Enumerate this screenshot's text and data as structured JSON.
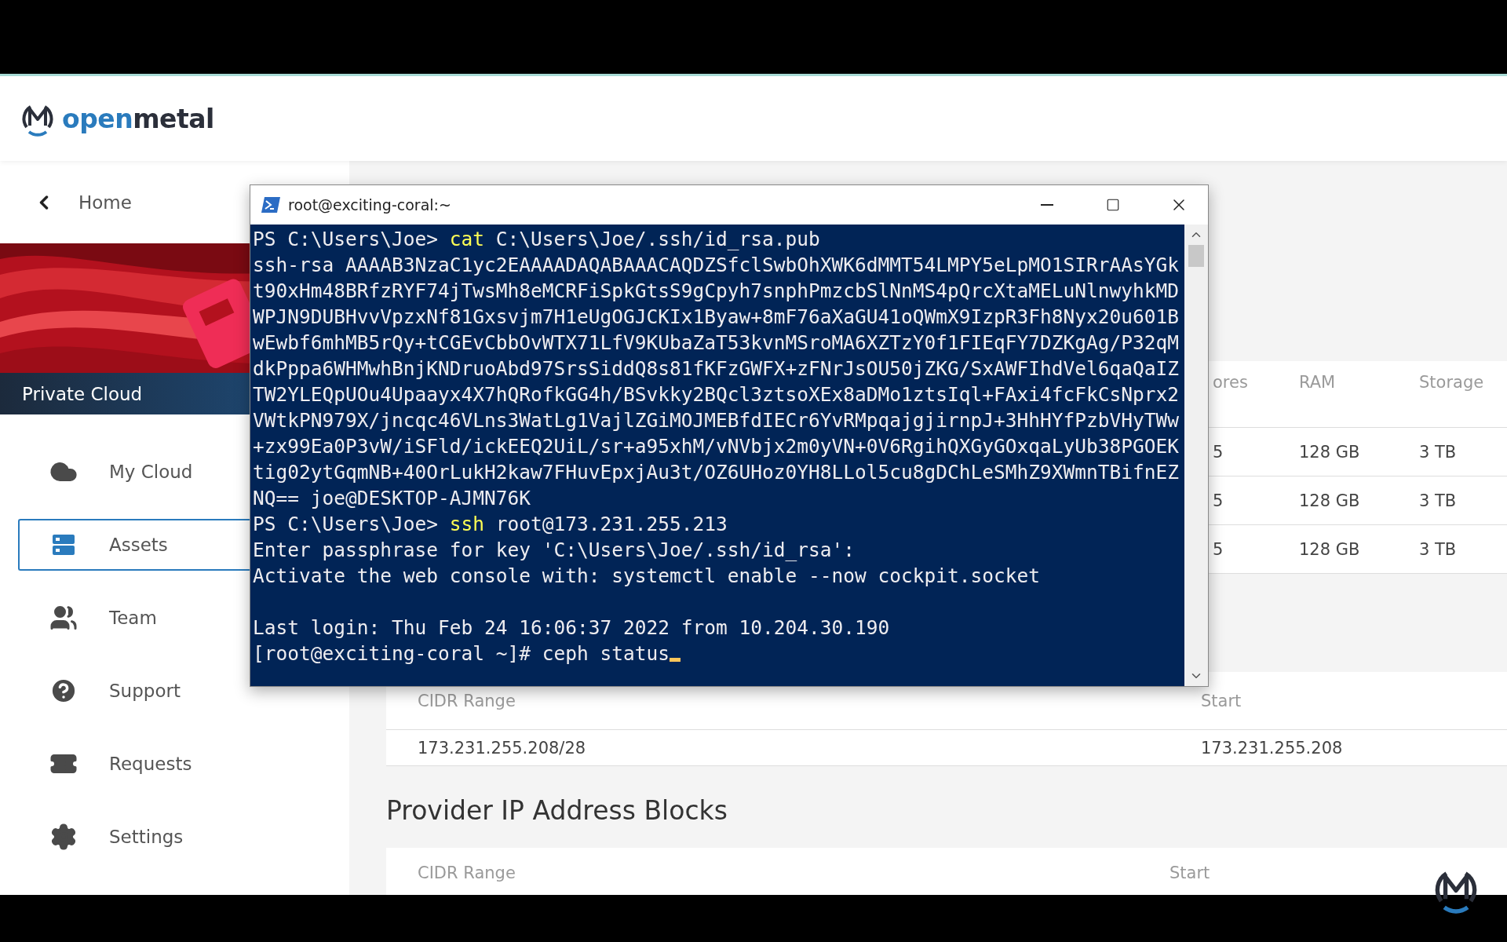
{
  "header": {
    "logo": {
      "part_1": "open",
      "part_2": "metal"
    }
  },
  "sidebar": {
    "back": {
      "label": "Home"
    },
    "banner": {
      "kind": "picture",
      "title": "Private Cloud"
    },
    "items": [
      {
        "label": "My Cloud",
        "selected": false
      },
      {
        "label": "Assets",
        "selected": true
      },
      {
        "label": "Team",
        "selected": false
      },
      {
        "label": "Support",
        "selected": false
      },
      {
        "label": "Requests",
        "selected": false
      },
      {
        "label": "Settings",
        "selected": false
      }
    ]
  },
  "content": {
    "hardware_table": {
      "columns": [
        "ores",
        "RAM",
        "Storage"
      ],
      "rows": [
        [
          "5",
          "128 GB",
          "3 TB"
        ],
        [
          "5",
          "128 GB",
          "3 TB"
        ],
        [
          "5",
          "128 GB",
          "3 TB"
        ]
      ]
    },
    "ip_table": {
      "columns": [
        "CIDR Range",
        "Start"
      ],
      "rows": [
        [
          "173.231.255.208/28",
          "173.231.255.208"
        ]
      ]
    },
    "provider_section": {
      "title": "Provider IP Address Blocks",
      "columns": [
        "CIDR Range",
        "Start"
      ]
    }
  },
  "terminal": {
    "title": "root@exciting-coral:~",
    "lines": [
      {
        "kind": "command",
        "prompt": "PS C:\\Users\\Joe>",
        "command": "cat",
        "args": "C:\\Users\\Joe/.ssh/id_rsa.pub"
      },
      {
        "kind": "output",
        "text": "ssh-rsa AAAAB3NzaC1yc2EAAAADAQABAAACAQDZSfclSwbOhXWK6dMMT54LMPY5eLpMO1SIRrAAsYGk"
      },
      {
        "kind": "output",
        "text": "t90xHm48BRfzRYF74jTwsMh8eMCRFiSpkGtsS9gCpyh7snphPmzcbSlNnMS4pQrcXtaMELuNlnwyhkMD"
      },
      {
        "kind": "output",
        "text": "WPJN9DUBHvvVpzxNf81Gxsvjm7H1eUgOGJCKIx1Byaw+8mF76aXaGU41oQWmX9IzpR3Fh8Nyx20u601B"
      },
      {
        "kind": "output",
        "text": "wEwbf6mhMB5rQy+tCGEvCbbOvWTX71LfV9KUbaZaT53kvnMSroMA6XZTzY0f1FIEqFY7DZKgAg/P32qM"
      },
      {
        "kind": "output",
        "text": "dkPppa6WHMwhBnjKNDruoAbd97SrsSiddQ8s81fKFzGWFX+zFNrJsOU50jZKG/SxAWFIhdVel6qaQaIZ"
      },
      {
        "kind": "output",
        "text": "TW2YLEQpUOu4Upaayx4X7hQRofkGG4h/BSvkky2BQcl3ztsoXEx8aDMo1ztsIql+FAxi4fcFkCsNprx2"
      },
      {
        "kind": "output",
        "text": "VWtkPN979X/jncqc46VLns3WatLg1VajlZGiMOJMEBfdIECr6YvRMpqajgjirnpJ+3HhHYfPzbVHyTWw"
      },
      {
        "kind": "output",
        "text": "+zx99Ea0P3vW/iSFld/ickEEQ2UiL/sr+a95xhM/vNVbjx2m0yVN+0V6RgihQXGyGOxqaLyUb38PGOEK"
      },
      {
        "kind": "output",
        "text": "tig02ytGqmNB+40OrLukH2kaw7FHuvEpxjAu3t/OZ6UHoz0YH8LLol5cu8gDChLeSMhZ9XWmnTBifnEZ"
      },
      {
        "kind": "output",
        "text": "NQ== joe@DESKTOP-AJMN76K"
      },
      {
        "kind": "command",
        "prompt": "PS C:\\Users\\Joe>",
        "command": "ssh",
        "args": "root@173.231.255.213"
      },
      {
        "kind": "output",
        "text": "Enter passphrase for key 'C:\\Users\\Joe/.ssh/id_rsa':"
      },
      {
        "kind": "output",
        "text": "Activate the web console with: systemctl enable --now cockpit.socket"
      },
      {
        "kind": "blank"
      },
      {
        "kind": "output",
        "text": "Last login: Thu Feb 24 16:06:37 2022 from 10.204.30.190"
      },
      {
        "kind": "output",
        "text": "[root@exciting-coral ~]# ceph status",
        "cursor": true
      }
    ]
  }
}
